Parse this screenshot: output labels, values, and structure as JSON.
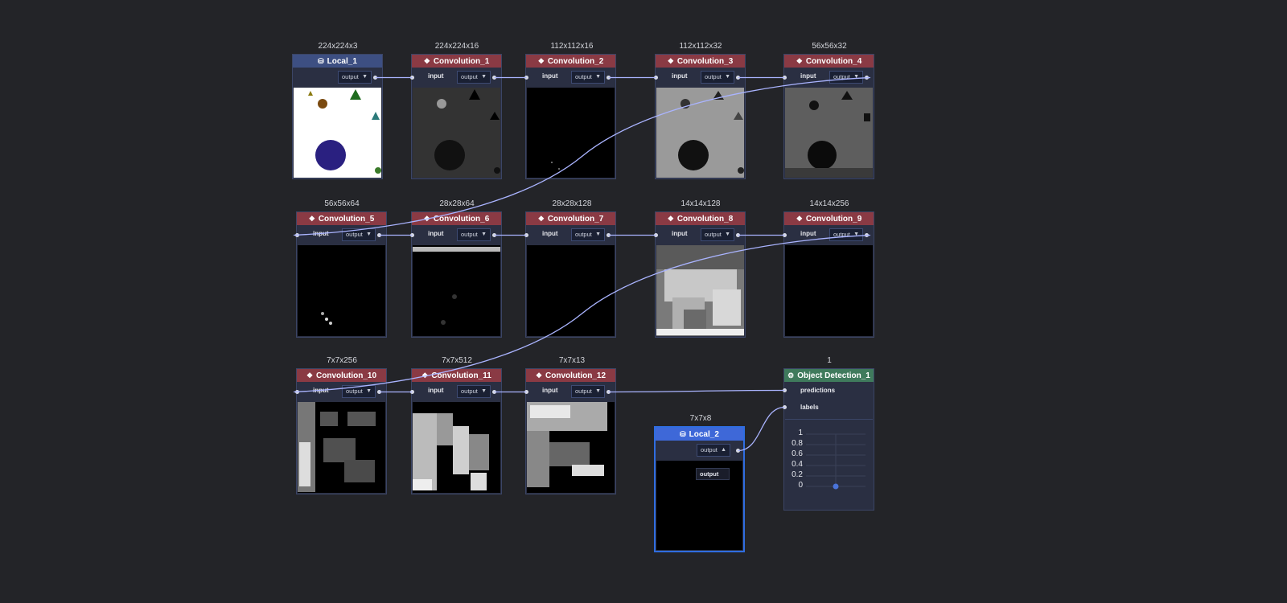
{
  "wire_color": "#aab4ff",
  "nodes": {
    "local_1": {
      "title": "Local_1",
      "shape": "224x224x3",
      "icon": "database-icon",
      "output": "output"
    },
    "conv_1": {
      "title": "Convolution_1",
      "shape": "224x224x16",
      "input": "input",
      "output": "output"
    },
    "conv_2": {
      "title": "Convolution_2",
      "shape": "112x112x16",
      "input": "input",
      "output": "output"
    },
    "conv_3": {
      "title": "Convolution_3",
      "shape": "112x112x32",
      "input": "input",
      "output": "output"
    },
    "conv_4": {
      "title": "Convolution_4",
      "shape": "56x56x32",
      "input": "input",
      "output": "output"
    },
    "conv_5": {
      "title": "Convolution_5",
      "shape": "56x56x64",
      "input": "input",
      "output": "output"
    },
    "conv_6": {
      "title": "Convolution_6",
      "shape": "28x28x64",
      "input": "input",
      "output": "output"
    },
    "conv_7": {
      "title": "Convolution_7",
      "shape": "28x28x128",
      "input": "input",
      "output": "output"
    },
    "conv_8": {
      "title": "Convolution_8",
      "shape": "14x14x128",
      "input": "input",
      "output": "output"
    },
    "conv_9": {
      "title": "Convolution_9",
      "shape": "14x14x256",
      "input": "input",
      "output": "output"
    },
    "conv_10": {
      "title": "Convolution_10",
      "shape": "7x7x256",
      "input": "input",
      "output": "output"
    },
    "conv_11": {
      "title": "Convolution_11",
      "shape": "7x7x512",
      "input": "input",
      "output": "output"
    },
    "conv_12": {
      "title": "Convolution_12",
      "shape": "7x7x13",
      "input": "input",
      "output": "output"
    },
    "local_2": {
      "title": "Local_2",
      "shape": "7x7x8",
      "icon": "database-icon",
      "output": "output",
      "dropdown_options": [
        "output"
      ]
    },
    "detect_1": {
      "title": "Object Detection_1",
      "shape": "1",
      "icon": "gear-icon",
      "predictions": "predictions",
      "labels": "labels",
      "yticks": [
        "1",
        "0.8",
        "0.6",
        "0.4",
        "0.2",
        "0"
      ],
      "point_color": "#4a73d9"
    }
  }
}
